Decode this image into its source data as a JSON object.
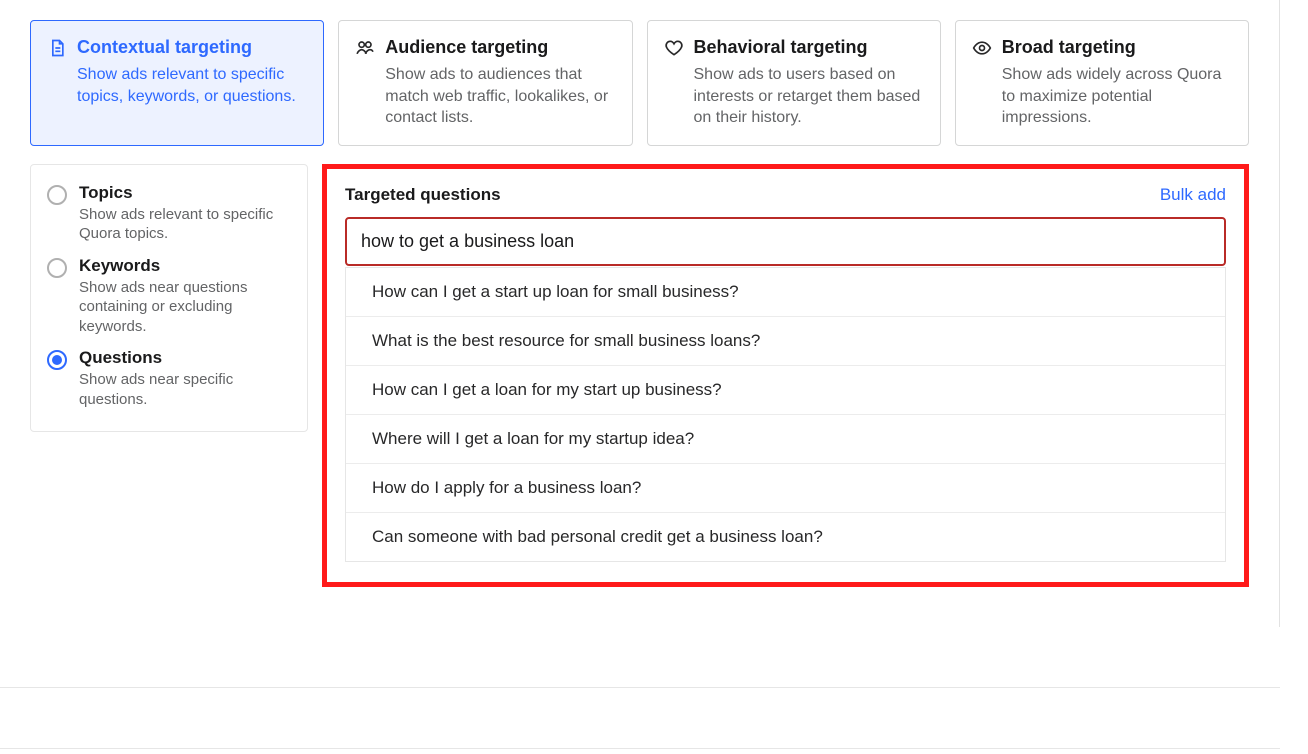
{
  "targeting_cards": [
    {
      "key": "contextual",
      "icon": "document-icon",
      "title": "Contextual targeting",
      "desc": "Show ads relevant to specific topics, keywords, or questions.",
      "selected": true
    },
    {
      "key": "audience",
      "icon": "users-icon",
      "title": "Audience targeting",
      "desc": "Show ads to audiences that match web traffic, lookalikes, or contact lists.",
      "selected": false
    },
    {
      "key": "behavioral",
      "icon": "heart-icon",
      "title": "Behavioral targeting",
      "desc": "Show ads to users based on interests or retarget them based on their history.",
      "selected": false
    },
    {
      "key": "broad",
      "icon": "eye-icon",
      "title": "Broad targeting",
      "desc": "Show ads widely across Quora to maximize potential impressions.",
      "selected": false
    }
  ],
  "contextual_options": [
    {
      "key": "topics",
      "title": "Topics",
      "desc": "Show ads relevant to specific Quora topics.",
      "selected": false
    },
    {
      "key": "keywords",
      "title": "Keywords",
      "desc": "Show ads near questions containing or excluding keywords.",
      "selected": false
    },
    {
      "key": "questions",
      "title": "Questions",
      "desc": "Show ads near specific questions.",
      "selected": true
    }
  ],
  "panel": {
    "title": "Targeted questions",
    "bulk_add_label": "Bulk add",
    "search_value": "how to get a business loan",
    "suggestions": [
      "How can I get a start up loan for small business?",
      "What is the best resource for small business loans?",
      "How can I get a loan for my start up business?",
      "Where will I get a loan for my startup idea?",
      "How do I apply for a business loan?",
      "Can someone with bad personal credit get a business loan?"
    ]
  },
  "colors": {
    "accent_blue": "#2e69ff",
    "highlight_red": "#ff1a1a",
    "input_border_red": "#b92b27",
    "text_muted": "#636466"
  }
}
